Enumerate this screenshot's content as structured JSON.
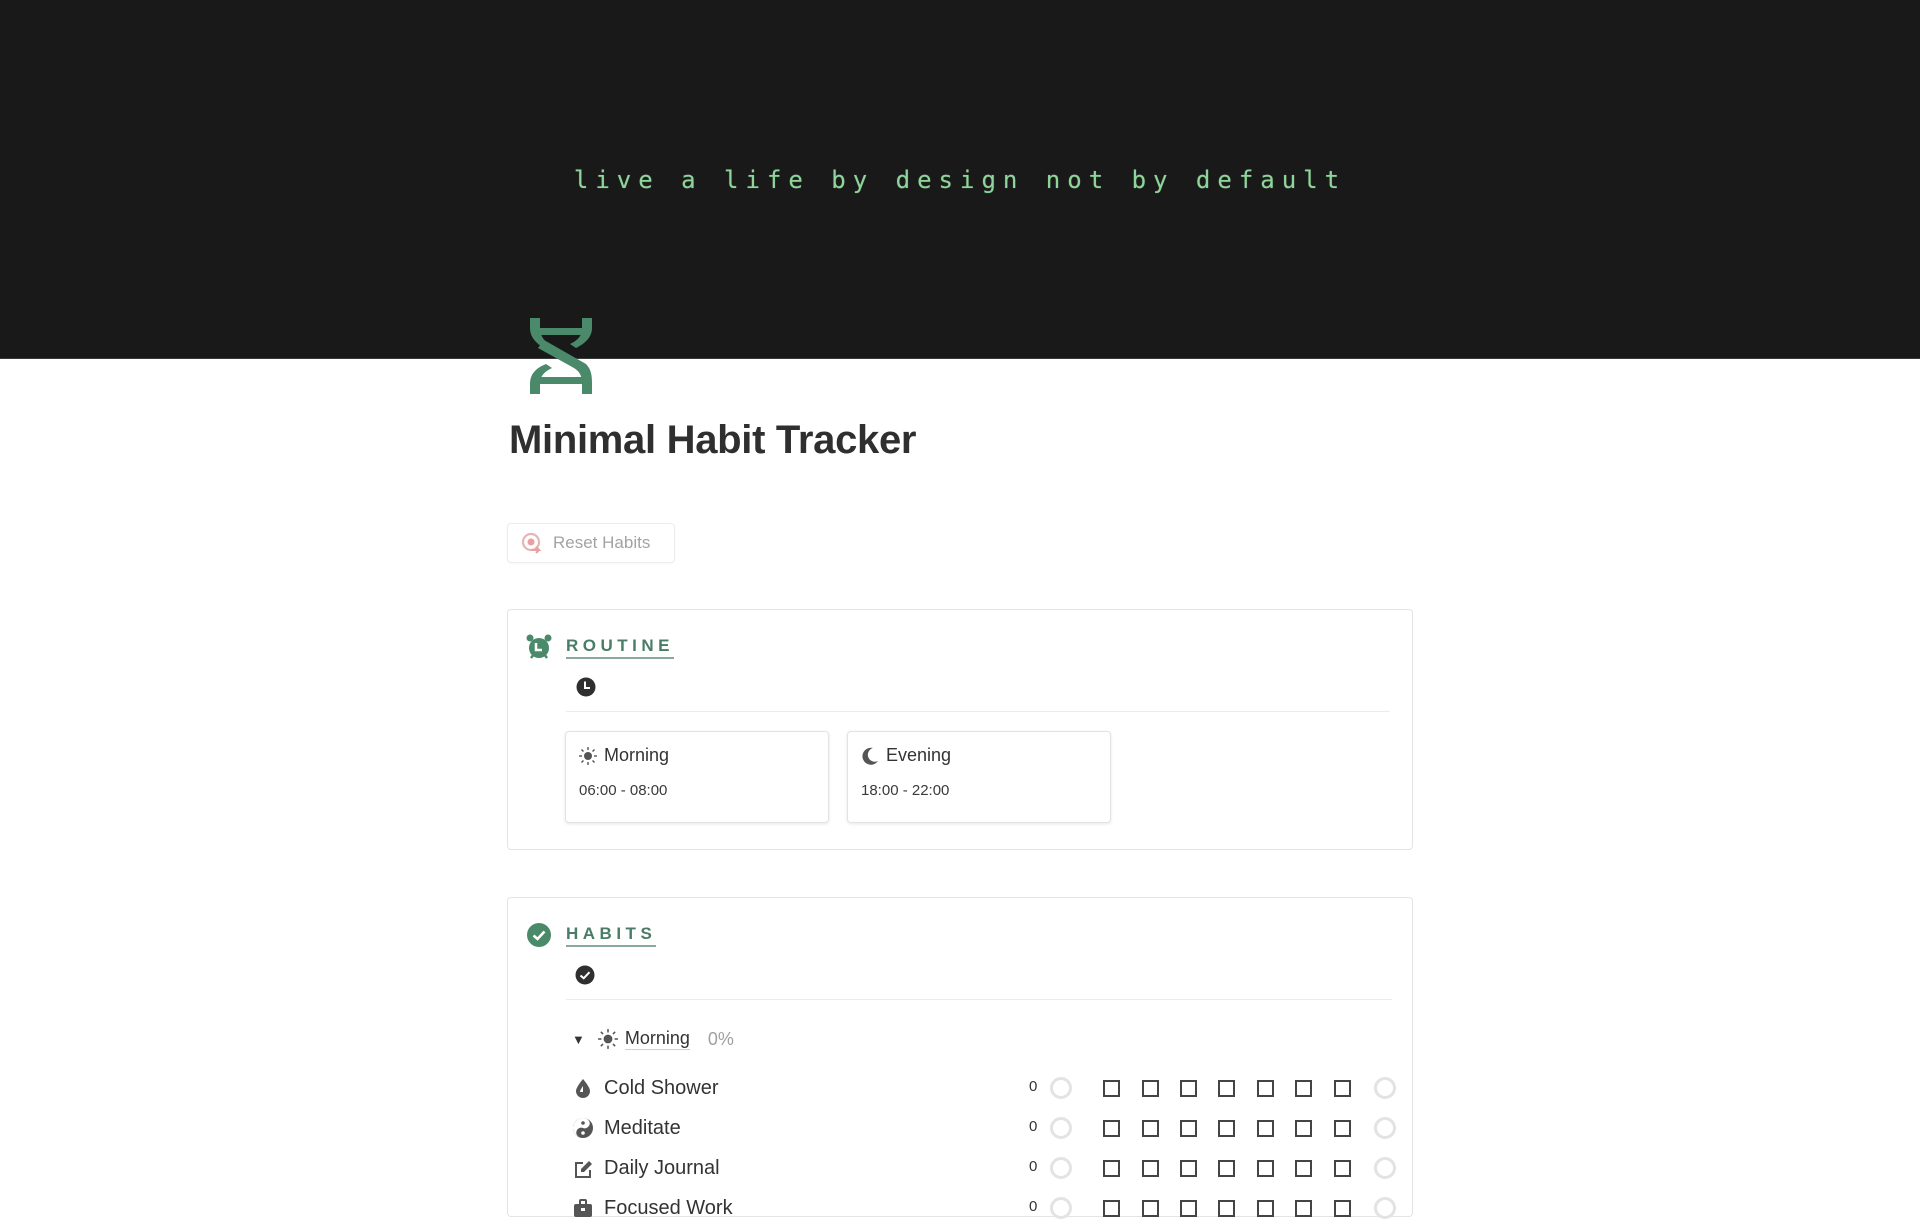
{
  "cover": {
    "quote": "live a life by design not by default"
  },
  "page": {
    "icon": "dna-icon",
    "title": "Minimal Habit Tracker",
    "accent_color": "#4a8a6a"
  },
  "reset_button": {
    "label": "Reset Habits",
    "icon": "reset-target-icon"
  },
  "routine": {
    "heading": "ROUTINE",
    "heading_icon": "alarm-clock-icon",
    "sub_icon": "clock-icon",
    "cards": [
      {
        "icon": "sun-icon",
        "title": "Morning",
        "time": "06:00 - 08:00"
      },
      {
        "icon": "moon-icon",
        "title": "Evening",
        "time": "18:00 - 22:00"
      }
    ]
  },
  "habits": {
    "heading": "HABITS",
    "heading_icon": "check-circle-icon",
    "sub_icon": "check-circle-icon",
    "group": {
      "icon": "sun-icon",
      "name": "Morning",
      "percent": "0%",
      "expanded": true
    },
    "rows": [
      {
        "icon": "water-drop-icon",
        "name": "Cold Shower",
        "count": "0",
        "days": [
          false,
          false,
          false,
          false,
          false,
          false,
          false
        ]
      },
      {
        "icon": "yin-yang-icon",
        "name": "Meditate",
        "count": "0",
        "days": [
          false,
          false,
          false,
          false,
          false,
          false,
          false
        ]
      },
      {
        "icon": "edit-note-icon",
        "name": "Daily Journal",
        "count": "0",
        "days": [
          false,
          false,
          false,
          false,
          false,
          false,
          false
        ]
      },
      {
        "icon": "work-icon",
        "name": "Focused Work",
        "count": "0",
        "days": [
          false,
          false,
          false,
          false,
          false,
          false,
          false
        ]
      }
    ]
  }
}
